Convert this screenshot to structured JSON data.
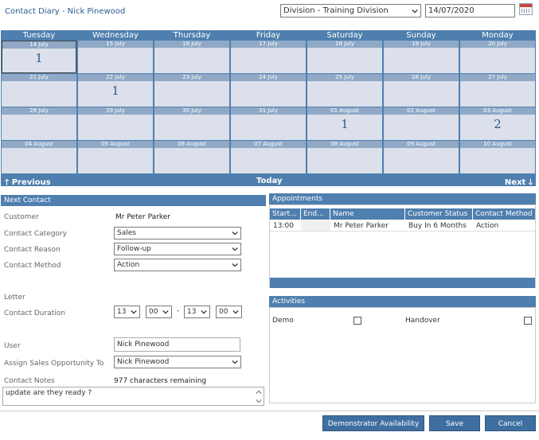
{
  "header": {
    "title": "Contact Diary - Nick Pinewood",
    "division": "Division - Training Division",
    "date": "14/07/2020"
  },
  "calendar": {
    "days": [
      "Tuesday",
      "Wednesday",
      "Thursday",
      "Friday",
      "Saturday",
      "Sunday",
      "Monday"
    ],
    "weeks": [
      [
        {
          "d": "14 July",
          "c": "1"
        },
        {
          "d": "15 July",
          "c": ""
        },
        {
          "d": "16 July",
          "c": ""
        },
        {
          "d": "17 July",
          "c": ""
        },
        {
          "d": "18 July",
          "c": ""
        },
        {
          "d": "19 July",
          "c": ""
        },
        {
          "d": "20 July",
          "c": ""
        }
      ],
      [
        {
          "d": "21 July",
          "c": ""
        },
        {
          "d": "22 July",
          "c": "1"
        },
        {
          "d": "23 July",
          "c": ""
        },
        {
          "d": "24 July",
          "c": ""
        },
        {
          "d": "25 July",
          "c": ""
        },
        {
          "d": "26 July",
          "c": ""
        },
        {
          "d": "27 July",
          "c": ""
        }
      ],
      [
        {
          "d": "28 July",
          "c": ""
        },
        {
          "d": "29 July",
          "c": ""
        },
        {
          "d": "30 July",
          "c": ""
        },
        {
          "d": "31 July",
          "c": ""
        },
        {
          "d": "01 August",
          "c": "1"
        },
        {
          "d": "02 August",
          "c": ""
        },
        {
          "d": "03 August",
          "c": "2"
        }
      ],
      [
        {
          "d": "04 August",
          "c": ""
        },
        {
          "d": "05 August",
          "c": ""
        },
        {
          "d": "06 August",
          "c": ""
        },
        {
          "d": "07 August",
          "c": ""
        },
        {
          "d": "08 August",
          "c": ""
        },
        {
          "d": "09 August",
          "c": ""
        },
        {
          "d": "10 August",
          "c": ""
        }
      ]
    ],
    "prev": "Previous",
    "today": "Today",
    "next": "Next"
  },
  "next_contact": {
    "heading": "Next Contact",
    "customer_label": "Customer",
    "customer_value": "Mr Peter Parker",
    "category_label": "Contact Category",
    "category_value": "Sales",
    "reason_label": "Contact Reason",
    "reason_value": "Follow-up",
    "method_label": "Contact Method",
    "method_value": "Action",
    "letter_label": "Letter",
    "duration_label": "Contact Duration",
    "duration": {
      "h1": "13",
      "m1": "00",
      "sep": "-",
      "h2": "13",
      "m2": "00"
    },
    "user_label": "User",
    "user_value": "Nick Pinewood",
    "assign_label": "Assign Sales Opportunity To",
    "assign_value": "Nick Pinewood",
    "notes_label": "Contact Notes",
    "notes_remaining": "977 characters remaining",
    "notes_value": "update are they ready ?"
  },
  "appointments": {
    "heading": "Appointments",
    "columns": [
      "Start...",
      "End...",
      "Name",
      "Customer Status",
      "Contact Method"
    ],
    "rows": [
      [
        "13:00",
        "",
        "Mr Peter Parker",
        "Buy In 6 Months",
        "Action"
      ]
    ]
  },
  "activities": {
    "heading": "Activities",
    "items": [
      {
        "label": "Demo",
        "checked": false
      },
      {
        "label": "Handover",
        "checked": false
      }
    ]
  },
  "buttons": {
    "demo_availability": "Demonstrator Availability",
    "save": "Save",
    "cancel": "Cancel"
  },
  "colors": {
    "accent": "#4f7fae",
    "cell": "#dbe0ea",
    "cell_date": "#8fa9c7"
  }
}
